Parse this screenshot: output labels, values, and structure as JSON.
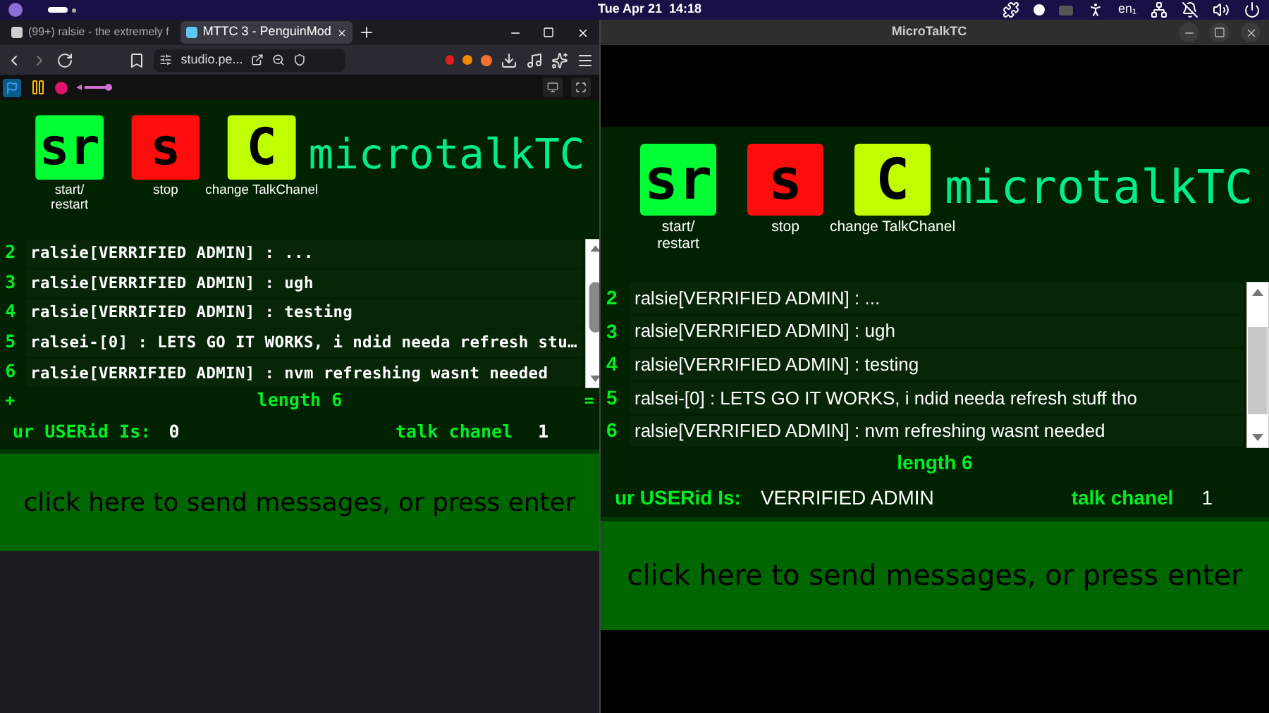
{
  "top_bar": {
    "clock": "Tue Apr 21  14:18",
    "keyboard_layout": "en₁"
  },
  "browser": {
    "tabs": [
      {
        "title": "(99+) ralsie - the extremely f",
        "selected": false
      },
      {
        "title": "MTTC 3 - PenguinMod",
        "selected": true
      }
    ],
    "address": "studio.pe...",
    "stage": {
      "buttons": [
        {
          "glyph": "sr",
          "label": "start/\nrestart",
          "color": "#00ff33"
        },
        {
          "glyph": "s",
          "label": "stop",
          "color": "#ff0d0d"
        },
        {
          "glyph": "C",
          "label": "change TalkChanel",
          "color": "#bfff00"
        }
      ],
      "title": "microtalkTC",
      "messages": [
        {
          "number": "2",
          "text": "ralsie[VERRIFIED ADMIN] : ..."
        },
        {
          "number": "3",
          "text": "ralsie[VERRIFIED ADMIN] : ugh"
        },
        {
          "number": "4",
          "text": "ralsie[VERRIFIED ADMIN] : testing"
        },
        {
          "number": "5",
          "text": "ralsei-[0] : LETS GO IT WORKS, i ndid needa refresh stu…"
        },
        {
          "number": "6",
          "text": "ralsie[VERRIFIED ADMIN] : nvm refreshing wasnt needed"
        }
      ],
      "corner_marks": [
        "+",
        "="
      ],
      "length": "length 6",
      "userid_label": "ur USERid Is:",
      "userid": "0",
      "channel_label": "talk chanel",
      "channel": "1",
      "send": "click here to send messages, or press enter"
    }
  },
  "app_window": {
    "title": "MicroTalkTC",
    "stage": {
      "buttons": [
        {
          "glyph": "sr",
          "label": "start/\nrestart",
          "color": "#00ff33"
        },
        {
          "glyph": "s",
          "label": "stop",
          "color": "#ff0d0d"
        },
        {
          "glyph": "C",
          "label": "change TalkChanel",
          "color": "#bfff00"
        }
      ],
      "title": "microtalkTC",
      "messages": [
        {
          "number": "2",
          "text": "ralsie[VERRIFIED ADMIN] : ..."
        },
        {
          "number": "3",
          "text": "ralsie[VERRIFIED ADMIN] : ugh"
        },
        {
          "number": "4",
          "text": "ralsie[VERRIFIED ADMIN] : testing"
        },
        {
          "number": "5",
          "text": "ralsei-[0] : LETS GO IT WORKS, i ndid needa refresh stuff tho"
        },
        {
          "number": "6",
          "text": "ralsie[VERRIFIED ADMIN] : nvm refreshing wasnt needed"
        }
      ],
      "length": "length 6",
      "userid_label": "ur USERid Is:",
      "userid": "VERRIFIED ADMIN",
      "channel_label": "talk chanel",
      "channel": "1",
      "send": "click here to send messages, or press enter"
    }
  }
}
